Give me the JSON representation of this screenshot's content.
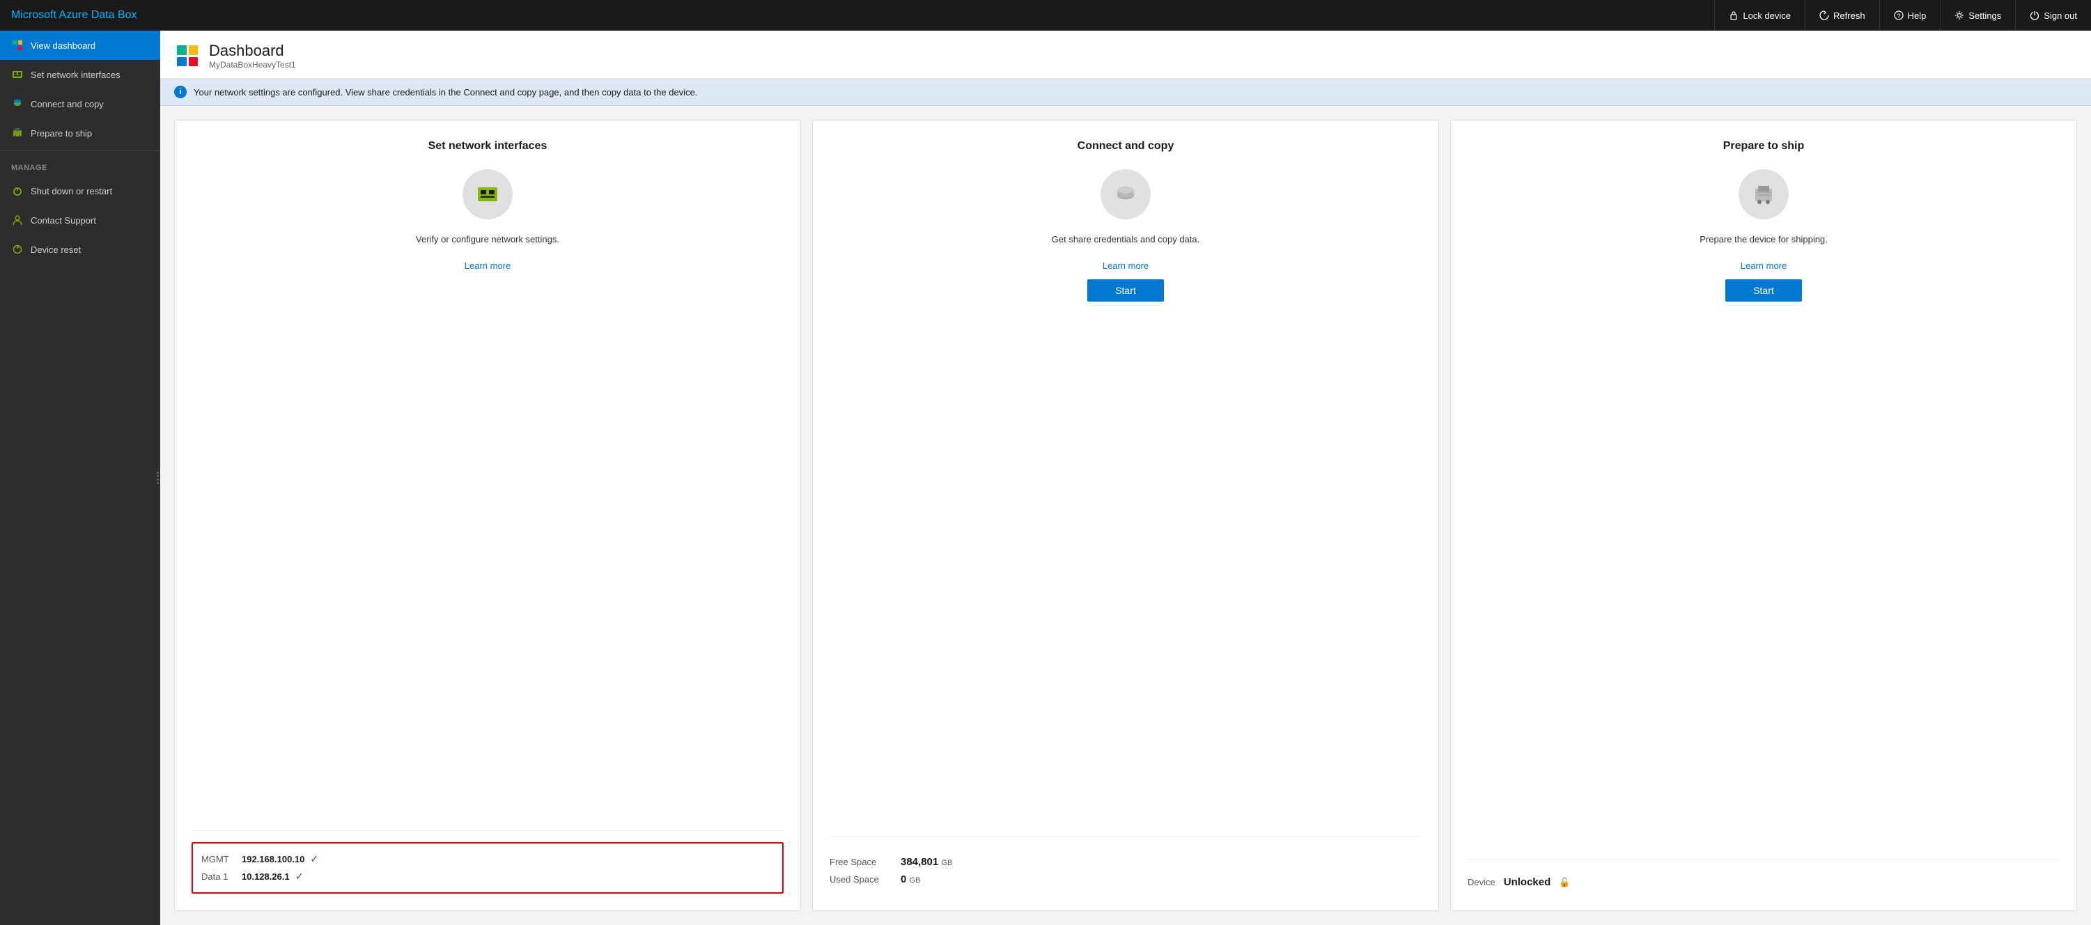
{
  "brand": {
    "title": "Microsoft Azure Data Box"
  },
  "topNav": {
    "actions": [
      {
        "id": "lock-device",
        "label": "Lock device",
        "icon": "lock"
      },
      {
        "id": "refresh",
        "label": "Refresh",
        "icon": "refresh"
      },
      {
        "id": "help",
        "label": "Help",
        "icon": "help"
      },
      {
        "id": "settings",
        "label": "Settings",
        "icon": "settings"
      },
      {
        "id": "sign-out",
        "label": "Sign out",
        "icon": "power"
      }
    ]
  },
  "sidebar": {
    "navItems": [
      {
        "id": "view-dashboard",
        "label": "View dashboard",
        "active": true
      },
      {
        "id": "set-network-interfaces",
        "label": "Set network interfaces",
        "active": false
      },
      {
        "id": "connect-and-copy",
        "label": "Connect and copy",
        "active": false
      },
      {
        "id": "prepare-to-ship",
        "label": "Prepare to ship",
        "active": false
      }
    ],
    "manageLabel": "MANAGE",
    "manageItems": [
      {
        "id": "shut-down-or-restart",
        "label": "Shut down or restart"
      },
      {
        "id": "contact-support",
        "label": "Contact Support"
      },
      {
        "id": "device-reset",
        "label": "Device reset"
      }
    ]
  },
  "dashboard": {
    "title": "Dashboard",
    "subtitle": "MyDataBoxHeavyTest1",
    "iconColors": [
      "#00b294",
      "#ffb900",
      "#0078d4",
      "#e81123"
    ]
  },
  "infoBanner": {
    "message": "Your network settings are configured. View share credentials in the Connect and copy page, and then copy data to the device."
  },
  "cards": [
    {
      "id": "set-network-interfaces",
      "title": "Set network interfaces",
      "description": "Verify or configure network settings.",
      "learnMoreLabel": "Learn more",
      "hasStart": false,
      "footer": {
        "type": "network",
        "rows": [
          {
            "label": "MGMT",
            "ip": "192.168.100.10",
            "ok": true
          },
          {
            "label": "Data 1",
            "ip": "10.128.26.1",
            "ok": true
          }
        ]
      }
    },
    {
      "id": "connect-and-copy",
      "title": "Connect and copy",
      "description": "Get share credentials and copy data.",
      "learnMoreLabel": "Learn more",
      "startLabel": "Start",
      "hasStart": true,
      "footer": {
        "type": "space",
        "rows": [
          {
            "label": "Free Space",
            "value": "384,801",
            "unit": "GB"
          },
          {
            "label": "Used Space",
            "value": "0",
            "unit": "GB"
          }
        ]
      }
    },
    {
      "id": "prepare-to-ship",
      "title": "Prepare to ship",
      "description": "Prepare the device for shipping.",
      "learnMoreLabel": "Learn more",
      "startLabel": "Start",
      "hasStart": true,
      "footer": {
        "type": "device",
        "label": "Device",
        "value": "Unlocked"
      }
    }
  ]
}
